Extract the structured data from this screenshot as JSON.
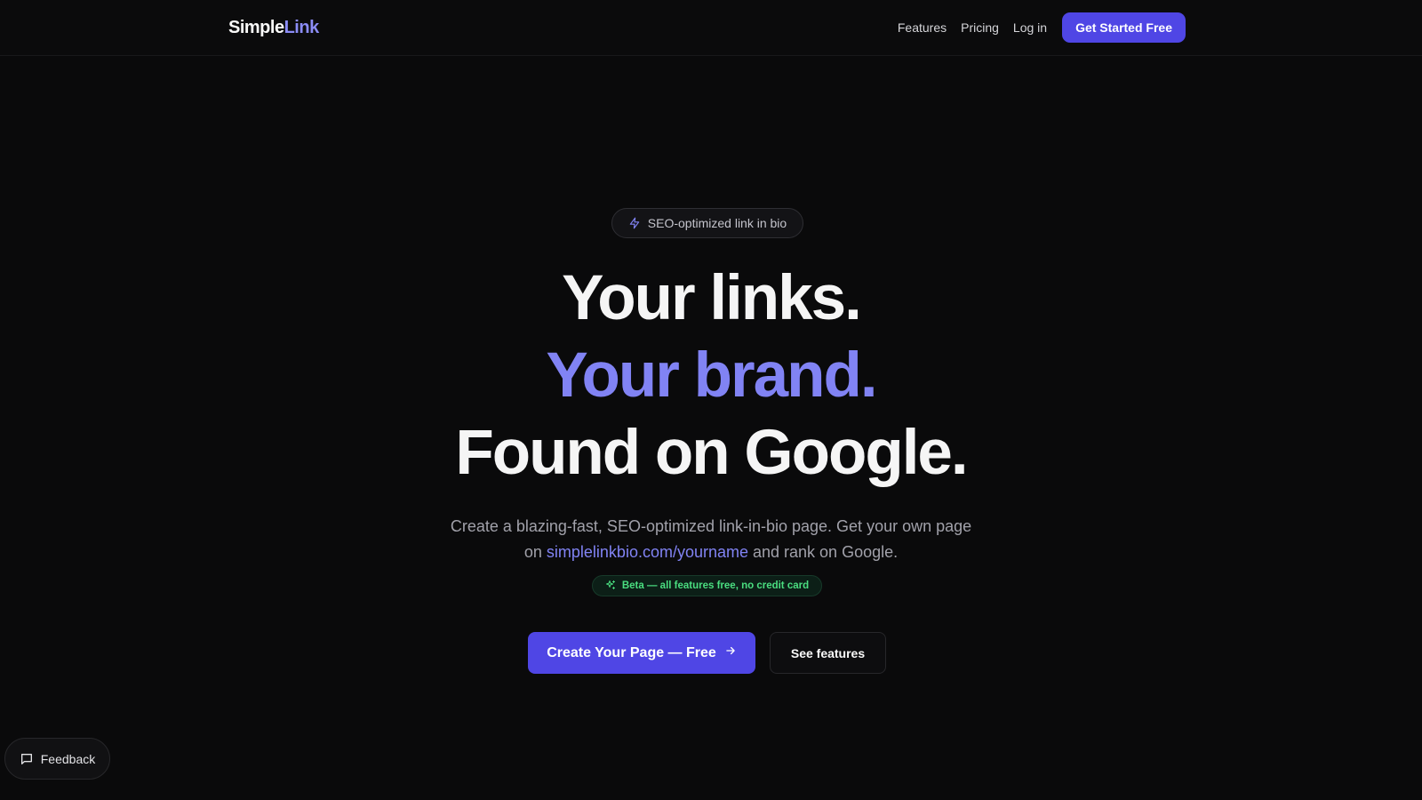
{
  "brand": {
    "name_part1": "Simple",
    "name_part2": "Link"
  },
  "nav": {
    "items": [
      {
        "label": "Features"
      },
      {
        "label": "Pricing"
      },
      {
        "label": "Log in"
      }
    ],
    "cta_label": "Get Started Free"
  },
  "hero": {
    "badge": {
      "icon": "lightning-icon",
      "label": "SEO-optimized link in bio"
    },
    "headline": {
      "line1": "Your links.",
      "line2": "Your brand.",
      "line3": "Found on Google."
    },
    "subtext": {
      "part1": "Create a blazing-fast, SEO-optimized link-in-bio page. Get your own page on ",
      "url": "simplelinkbio.com/yourname",
      "part2": " and rank on Google."
    },
    "beta": {
      "icon": "sparkles-icon",
      "label": "Beta — all features free, no credit card"
    },
    "primary_cta": {
      "label": "Create Your Page — Free",
      "icon": "arrow-right-icon"
    },
    "secondary_cta": {
      "label": "See features"
    }
  },
  "feedback": {
    "label": "Feedback",
    "icon": "message-square-icon"
  },
  "colors": {
    "background": "#0a0a0b",
    "accent": "#4f46e5",
    "accent_text": "#8183f4",
    "beta_green": "#4ade80"
  }
}
